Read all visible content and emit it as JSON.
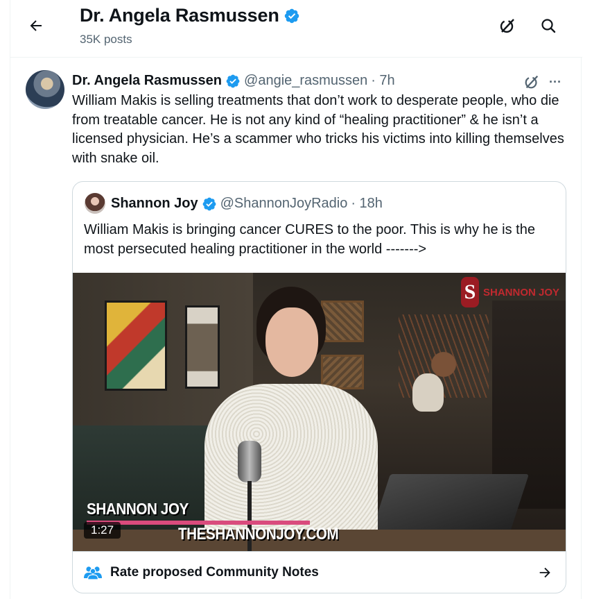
{
  "header": {
    "title": "Dr. Angela Rasmussen",
    "posts_count": "35K posts",
    "icons": [
      "back-arrow-icon",
      "grok-icon",
      "search-icon"
    ]
  },
  "tweet": {
    "author_name": "Dr. Angela Rasmussen",
    "handle": "@angie_rasmussen",
    "time": "· 7h",
    "text": "William Makis is selling treatments that don’t work to desperate people, who die from treatable cancer. He is not any kind of “healing practitioner” & he isn’t a licensed physician. He’s a scammer who tricks his victims into killing themselves with snake oil.",
    "more_label": "···"
  },
  "quote": {
    "author_name": "Shannon Joy",
    "handle": "@ShannonJoyRadio",
    "time": "· 18h",
    "text": "William Makis is bringing cancer CURES to the poor. This is why he is the most persecuted healing practitioner in the world ------->",
    "video": {
      "brand": "SHANNON JOY",
      "brand_logo": "S",
      "lower_third_name": "SHANNON JOY",
      "lower_third_url": "THESHANNONJOY.COM",
      "duration": "1:27"
    }
  },
  "community_notes": {
    "label": "Rate proposed Community Notes"
  },
  "colors": {
    "verified": "#1d9bf0",
    "secondary_text": "#536471",
    "border": "#cfd9de",
    "brand_red": "#9b1c23",
    "notes_icon": "#1d9bf0"
  }
}
